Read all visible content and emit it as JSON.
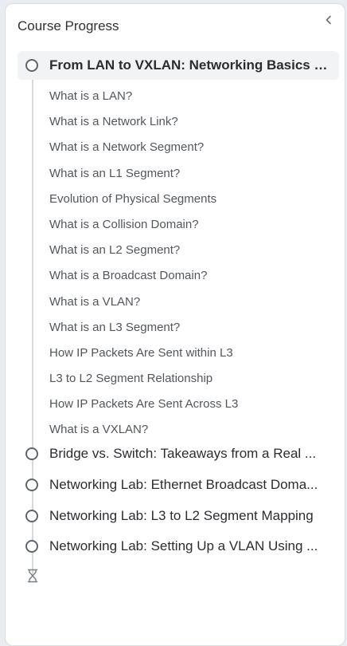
{
  "sidebar": {
    "title": "Course Progress",
    "collapse_icon": "chevron-left-icon",
    "modules": [
      {
        "title": "From LAN to VXLAN: Networking Basics fo...",
        "active": true,
        "lessons": [
          "What is a LAN?",
          "What is a Network Link?",
          "What is a Network Segment?",
          "What is an L1 Segment?",
          "Evolution of Physical Segments",
          "What is a Collision Domain?",
          "What is an L2 Segment?",
          "What is a Broadcast Domain?",
          "What is a VLAN?",
          "What is an L3 Segment?",
          "How IP Packets Are Sent within L3",
          "L3 to L2 Segment Relationship",
          "How IP Packets Are Sent Across L3",
          "What is a VXLAN?"
        ]
      },
      {
        "title": "Bridge vs. Switch: Takeaways from a Real ...",
        "active": false
      },
      {
        "title": "Networking Lab: Ethernet Broadcast Doma...",
        "active": false
      },
      {
        "title": "Networking Lab: L3 to L2 Segment Mapping",
        "active": false
      },
      {
        "title": "Networking Lab: Setting Up a VLAN Using ...",
        "active": false
      }
    ],
    "end_icon": "hourglass-icon",
    "colors": {
      "active_bg": "#f1f3f5",
      "rail": "#d5d9de",
      "circle": "#60656c"
    }
  }
}
